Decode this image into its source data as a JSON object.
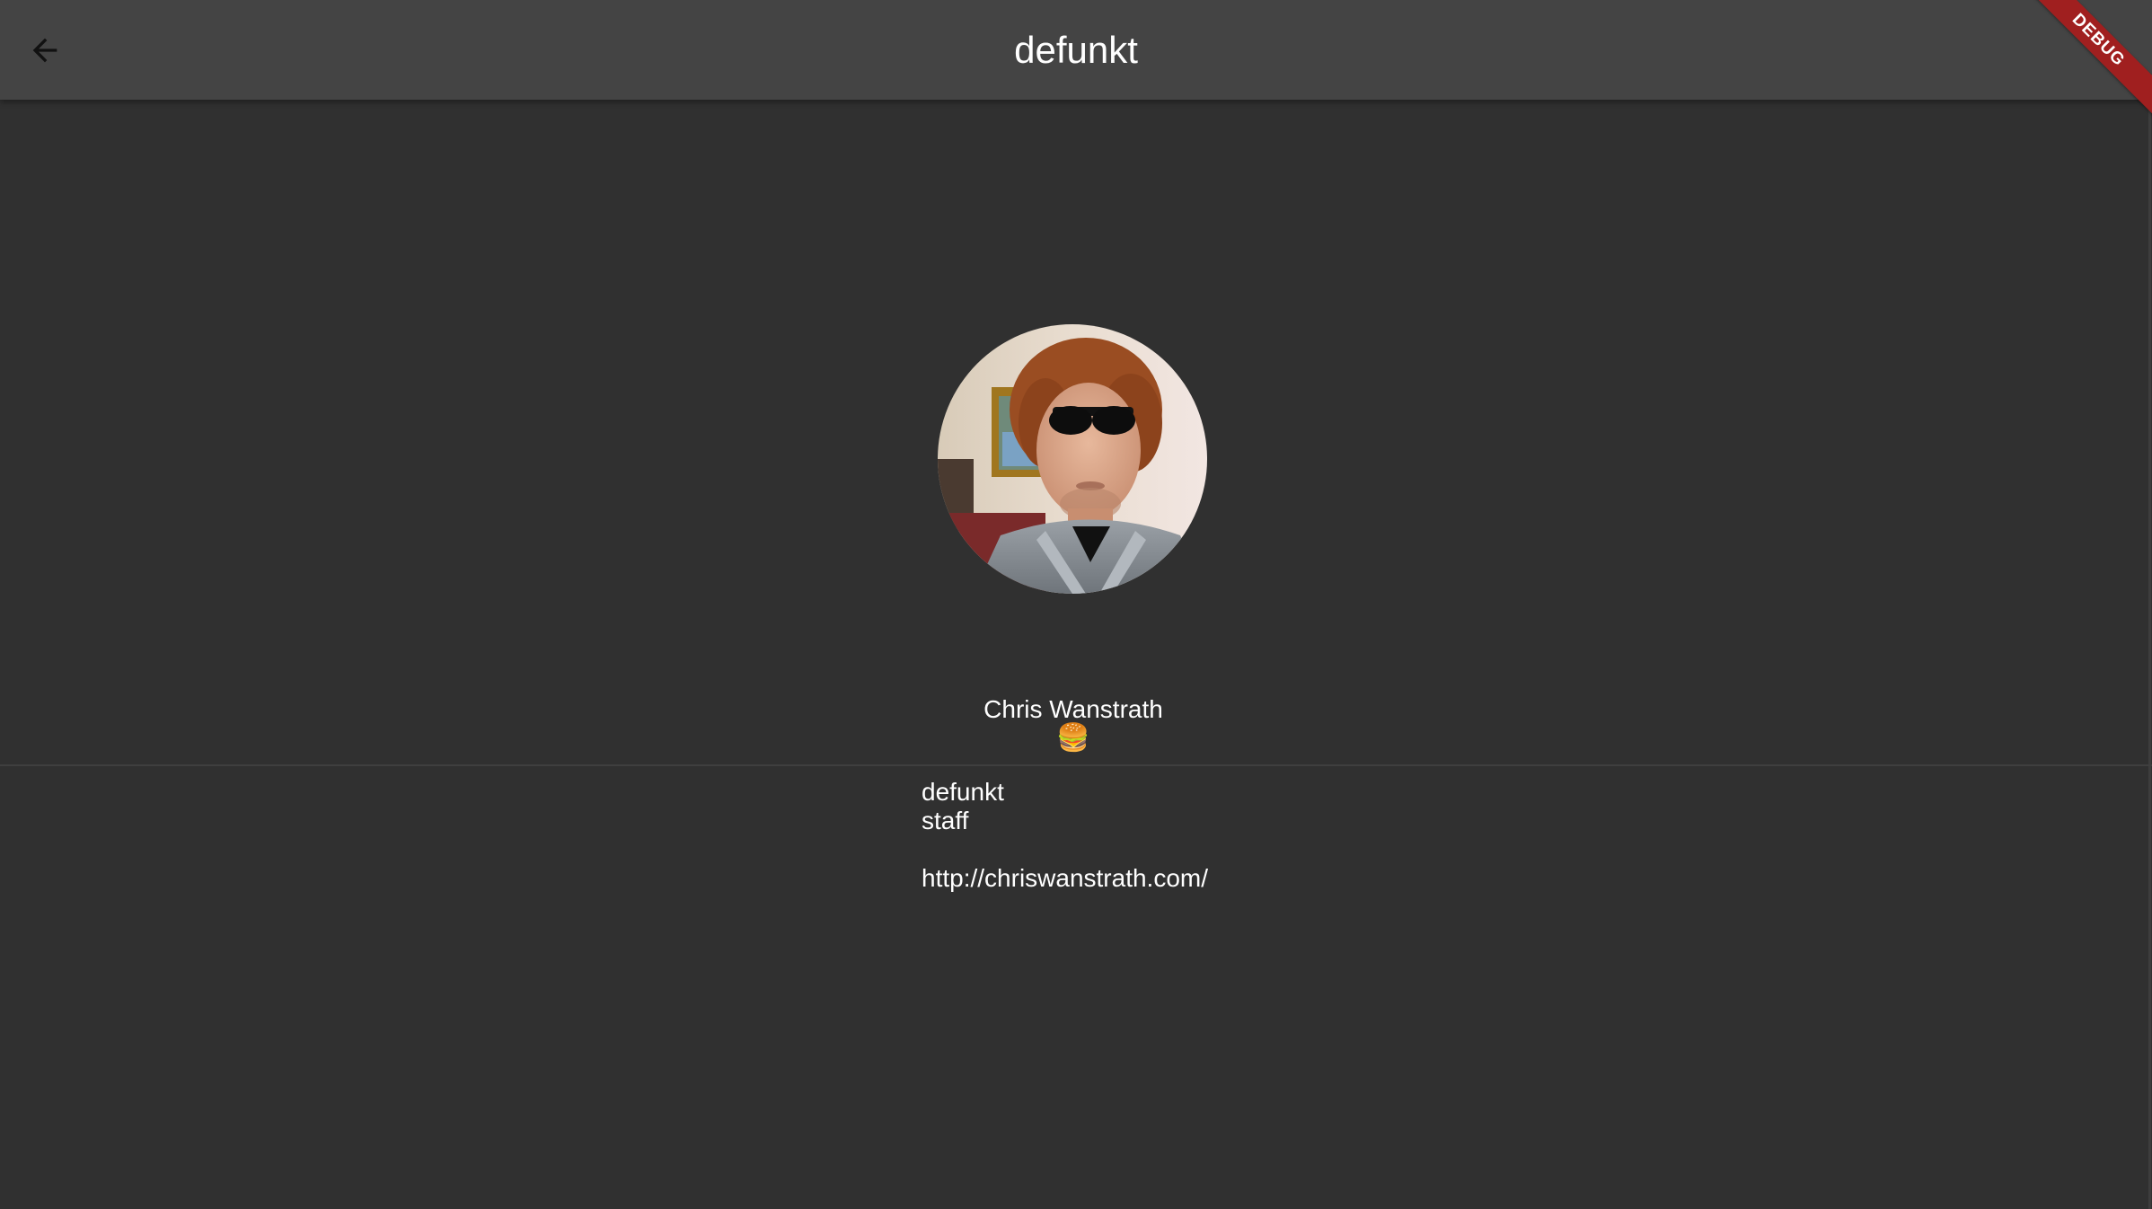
{
  "app_bar": {
    "title": "defunkt",
    "back_icon": "arrow-back-icon"
  },
  "debug_banner": {
    "label": "DEBUG"
  },
  "profile": {
    "display_name": "Chris Wanstrath",
    "bio_emoji": "🍔",
    "login": "defunkt",
    "type": "staff",
    "blog_url": "http://chriswanstrath.com/"
  },
  "colors": {
    "background": "#303030",
    "app_bar": "#444444",
    "debug_ribbon": "#a01f1f",
    "text": "#ffffff"
  }
}
